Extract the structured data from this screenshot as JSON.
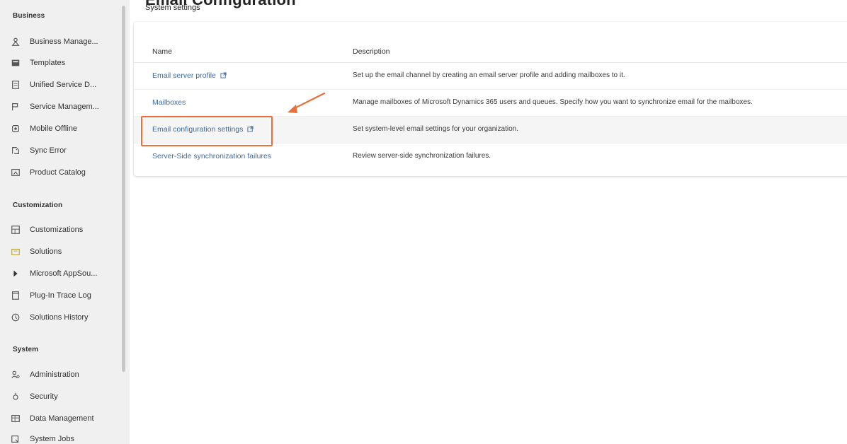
{
  "sidebar": {
    "sections": [
      {
        "title": "Business",
        "items": [
          {
            "label": "Business Manage...",
            "icon": "business-management-icon"
          },
          {
            "label": "Templates",
            "icon": "templates-icon"
          },
          {
            "label": "Unified Service D...",
            "icon": "unified-service-icon"
          },
          {
            "label": "Service Managem...",
            "icon": "service-management-icon"
          },
          {
            "label": "Mobile Offline",
            "icon": "mobile-offline-icon"
          },
          {
            "label": "Sync Error",
            "icon": "sync-error-icon"
          },
          {
            "label": "Product Catalog",
            "icon": "product-catalog-icon"
          }
        ]
      },
      {
        "title": "Customization",
        "items": [
          {
            "label": "Customizations",
            "icon": "customizations-icon"
          },
          {
            "label": "Solutions",
            "icon": "solutions-icon"
          },
          {
            "label": "Microsoft AppSou...",
            "icon": "appsource-icon"
          },
          {
            "label": "Plug-In Trace Log",
            "icon": "plugin-trace-log-icon"
          },
          {
            "label": "Solutions History",
            "icon": "solutions-history-icon"
          }
        ]
      },
      {
        "title": "System",
        "items": [
          {
            "label": "Administration",
            "icon": "administration-icon"
          },
          {
            "label": "Security",
            "icon": "security-icon"
          },
          {
            "label": "Data Management",
            "icon": "data-management-icon"
          },
          {
            "label": "System Jobs",
            "icon": "system-jobs-icon"
          }
        ]
      }
    ]
  },
  "main": {
    "title": "Email Configuration",
    "subtitle": "System settings",
    "table": {
      "columns": [
        "Name",
        "Description"
      ],
      "rows": [
        {
          "name": "Email server profile",
          "external": true,
          "description": "Set up the email channel by creating an email server profile and adding mailboxes to it."
        },
        {
          "name": "Mailboxes",
          "external": false,
          "description": "Manage mailboxes of Microsoft Dynamics 365 users and queues. Specify how you want to synchronize email for the mailboxes."
        },
        {
          "name": "Email configuration settings",
          "external": true,
          "description": "Set system-level email settings for your organization."
        },
        {
          "name": "Server-Side synchronization failures",
          "external": false,
          "description": "Review server-side synchronization failures."
        }
      ]
    }
  },
  "colors": {
    "link": "#3b6ba5",
    "highlight": "#e8703a",
    "sidebar_bg": "#f0f0f0"
  }
}
